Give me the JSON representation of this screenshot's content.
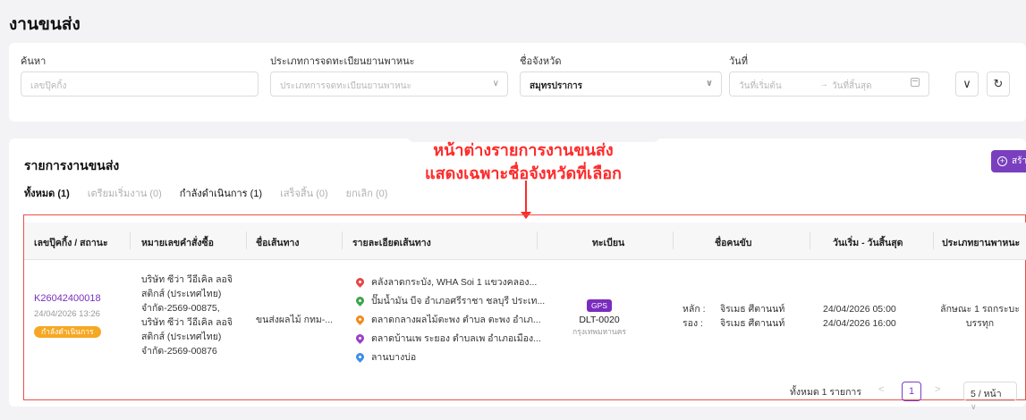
{
  "header": {
    "title": "งานขนส่ง"
  },
  "filters": {
    "search": {
      "label": "ค้นหา",
      "placeholder": "เลขปุ๊คกิ้ง"
    },
    "vehicle_type": {
      "label": "ประเภทการจดทะเบียนยานพาหนะ",
      "placeholder": "ประเภทการจดทะเบียนยานพาหนะ"
    },
    "province": {
      "label": "ชื่อจังหวัด",
      "value": "สมุทรปราการ"
    },
    "date": {
      "label": "วันที่",
      "start_placeholder": "วันที่เริ่มต้น",
      "arrow": "→",
      "end_placeholder": "วันที่สิ้นสุด"
    },
    "expand_icon": "chevron-down-icon",
    "reset_icon": "refresh-icon"
  },
  "list": {
    "title": "รายการงานขนส่ง",
    "create_button": "สร้างงานขนส่ง",
    "annotation": {
      "line1": "หน้าต่างรายการงานขนส่ง",
      "line2": "แสดงเฉพาะชื่อจังหวัดที่เลือก"
    },
    "tabs": [
      {
        "label": "ทั้งหมด (1)"
      },
      {
        "label": "เตรียมเริ่มงาน (0)"
      },
      {
        "label": "กำลังดำเนินการ (1)"
      },
      {
        "label": "เสร็จสิ้น (0)"
      },
      {
        "label": "ยกเลิก (0)"
      }
    ],
    "columns": [
      "เลขปุ๊คกิ้ง / สถานะ",
      "หมายเลขคำสั่งซื้อ",
      "ชื่อเส้นทาง",
      "รายละเอียดเส้นทาง",
      "ทะเบียน",
      "ชื่อคนขับ",
      "วันเริ่ม - วันสิ้นสุด",
      "ประเภทยานพาหนะ"
    ],
    "rows": [
      {
        "booking_id": "K26042400018",
        "booking_date": "24/04/2026 13:26",
        "status": "กำลังดำเนินการ",
        "orders": [
          "บริษัท ซีว่า วีอีเคิล ลอจิ",
          "สติกส์ (ประเทศไทย)",
          "จำกัด-2569-00875,",
          "บริษัท ซีว่า วีอีเคิล ลอจิ",
          "สติกส์ (ประเทศไทย)",
          "จำกัด-2569-00876"
        ],
        "route_name": "ขนส่งผลไม้ กทม-...",
        "stops": [
          {
            "text": "คลังลาดกระบัง, WHA Soi 1 แขวงคลอง...",
            "color": "#e84545"
          },
          {
            "text": "ปั๊มน้ำมัน บีจ อำเภอศรีราชา ชลบุรี ประเท...",
            "color": "#3fa34d"
          },
          {
            "text": "ตลาดกลางผลไม้ตะพง ตำบล ตะพง อำเภ...",
            "color": "#f28a1e"
          },
          {
            "text": "ตลาดบ้านเพ ระยอง ตำบลเพ อำเภอเมือง...",
            "color": "#9b3fc4"
          },
          {
            "text": "ลานบางบ่อ",
            "color": "#3f8de8"
          }
        ],
        "gps": "GPS",
        "plate": "DLT-0020",
        "plate_province": "กรุงเทพมหานคร",
        "driver_main_label": "หลัก :",
        "driver_main": "จิรเมธ ศีตานนท์",
        "driver_sub_label": "รอง :",
        "driver_sub": "จิรเมธ ศีตานนท์",
        "start": "24/04/2026 05:00",
        "end": "24/04/2026 16:00",
        "vehicle_type": [
          "ลักษณะ 1 รถกระบะ",
          "บรรทุก"
        ]
      }
    ],
    "pagination": {
      "total": "ทั้งหมด 1 รายการ",
      "prev": "<",
      "current": "1",
      "next": ">",
      "page_size": "5 / หน้า"
    }
  }
}
